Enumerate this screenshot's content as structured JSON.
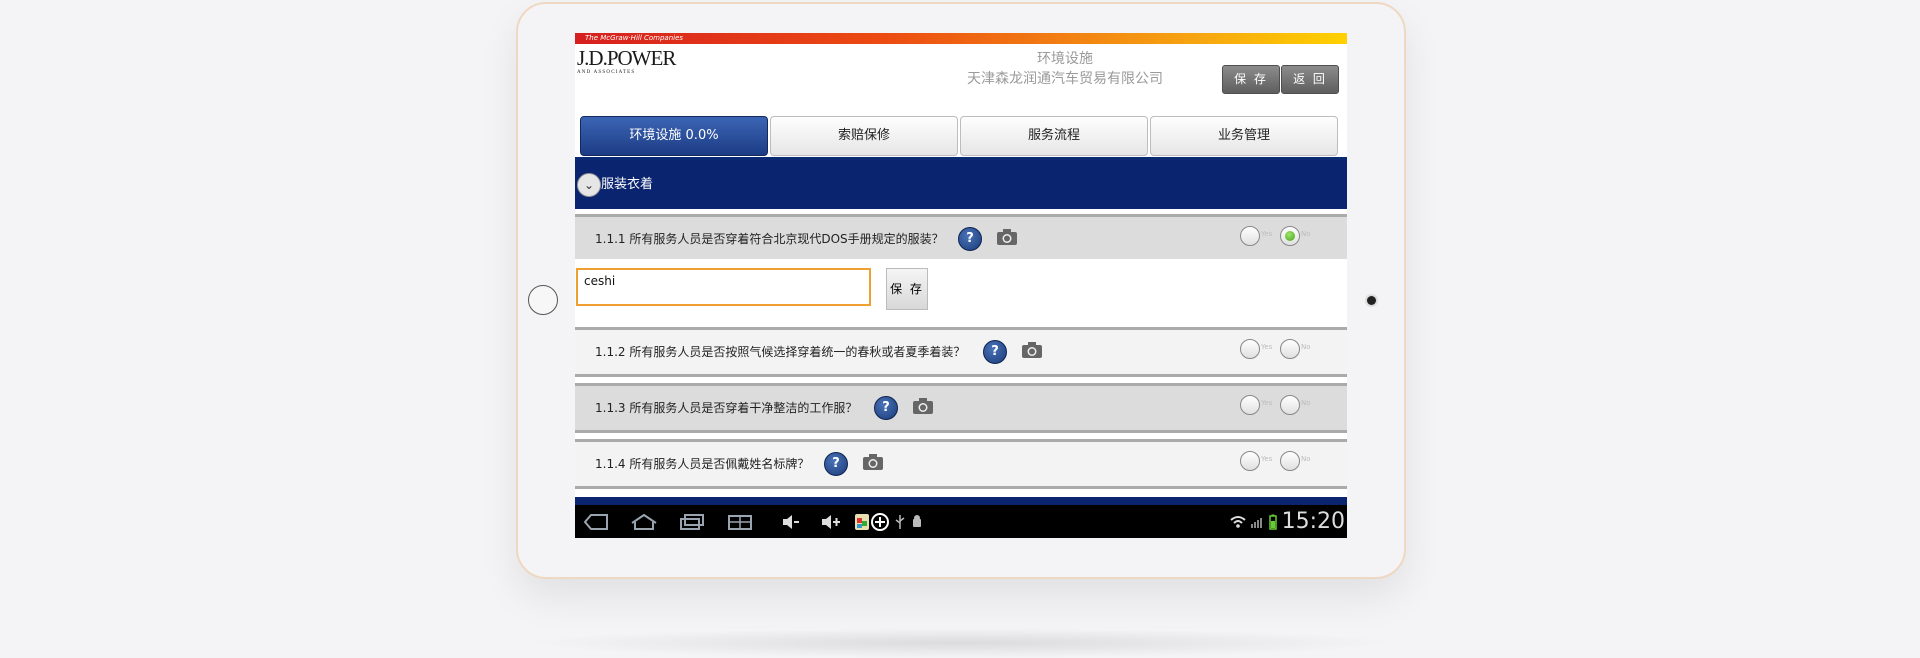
{
  "header": {
    "brand_tagline": "The McGraw·Hill Companies",
    "logo_main": "J.D.POWER",
    "logo_sub": "AND ASSOCIATES",
    "title": "环境设施",
    "dealer": "天津森龙润通汽车贸易有限公司",
    "save_label": "保 存",
    "back_label": "返 回"
  },
  "tabs": [
    {
      "label": "环境设施 0.0%",
      "active": true
    },
    {
      "label": "索赔保修",
      "active": false
    },
    {
      "label": "服务流程",
      "active": false
    },
    {
      "label": "业务管理",
      "active": false
    }
  ],
  "section": {
    "title": "服装衣着"
  },
  "questions": [
    {
      "text": "1.1.1 所有服务人员是否穿着符合北京现代DOS手册规定的服装？",
      "selected": "No"
    },
    {
      "text": "1.1.2 所有服务人员是否按照气候选择穿着统一的春秋或者夏季着装？",
      "selected": null
    },
    {
      "text": "1.1.3 所有服务人员是否穿着干净整洁的工作服？",
      "selected": null
    },
    {
      "text": "1.1.4 所有服务人员是否佩戴姓名标牌？",
      "selected": null
    }
  ],
  "radio_labels": {
    "yes": "Yes",
    "no": "No"
  },
  "comment": {
    "value": "ceshi",
    "save_label": "保 存"
  },
  "icons": {
    "help": "?",
    "camera": "camera-icon",
    "chevron": "⌄"
  },
  "statusbar": {
    "time": "15:20"
  }
}
